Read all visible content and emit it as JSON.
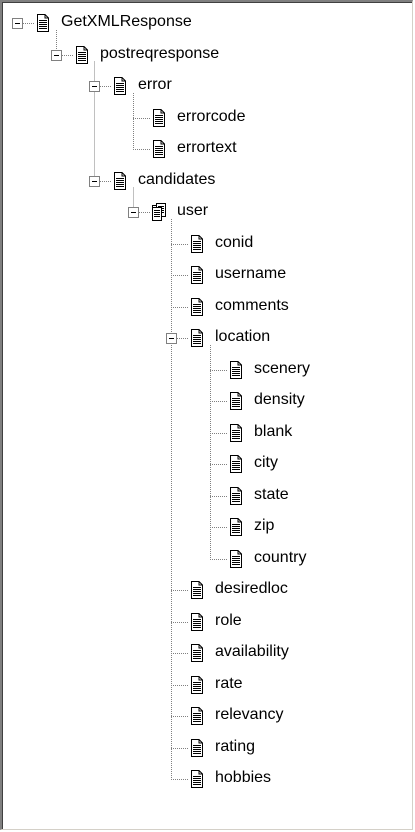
{
  "tree": {
    "nodes": [
      {
        "label": "GetXMLResponse",
        "depth": 0,
        "expanded": true,
        "icon": "document-icon"
      },
      {
        "label": "postreqresponse",
        "depth": 1,
        "expanded": true,
        "icon": "document-icon"
      },
      {
        "label": "error",
        "depth": 2,
        "expanded": true,
        "icon": "document-icon"
      },
      {
        "label": "errorcode",
        "depth": 3,
        "icon": "document-icon"
      },
      {
        "label": "errortext",
        "depth": 3,
        "icon": "document-icon"
      },
      {
        "label": "candidates",
        "depth": 2,
        "expanded": true,
        "icon": "document-icon"
      },
      {
        "label": "user",
        "depth": 3,
        "expanded": true,
        "icon": "multi-document-icon"
      },
      {
        "label": "conid",
        "depth": 4,
        "icon": "document-icon"
      },
      {
        "label": "username",
        "depth": 4,
        "icon": "document-icon"
      },
      {
        "label": "comments",
        "depth": 4,
        "icon": "document-icon"
      },
      {
        "label": "location",
        "depth": 4,
        "expanded": true,
        "icon": "document-icon"
      },
      {
        "label": "scenery",
        "depth": 5,
        "icon": "document-icon"
      },
      {
        "label": "density",
        "depth": 5,
        "icon": "document-icon"
      },
      {
        "label": "blank",
        "depth": 5,
        "icon": "document-icon"
      },
      {
        "label": "city",
        "depth": 5,
        "icon": "document-icon"
      },
      {
        "label": "state",
        "depth": 5,
        "icon": "document-icon"
      },
      {
        "label": "zip",
        "depth": 5,
        "icon": "document-icon"
      },
      {
        "label": "country",
        "depth": 5,
        "icon": "document-icon"
      },
      {
        "label": "desiredloc",
        "depth": 4,
        "icon": "document-icon"
      },
      {
        "label": "role",
        "depth": 4,
        "icon": "document-icon"
      },
      {
        "label": "availability",
        "depth": 4,
        "icon": "document-icon"
      },
      {
        "label": "rate",
        "depth": 4,
        "icon": "document-icon"
      },
      {
        "label": "relevancy",
        "depth": 4,
        "icon": "document-icon"
      },
      {
        "label": "rating",
        "depth": 4,
        "icon": "document-icon"
      },
      {
        "label": "hobbies",
        "depth": 4,
        "icon": "document-icon"
      }
    ]
  },
  "colors": {
    "line": "#808080",
    "expander_border": "#808080"
  }
}
